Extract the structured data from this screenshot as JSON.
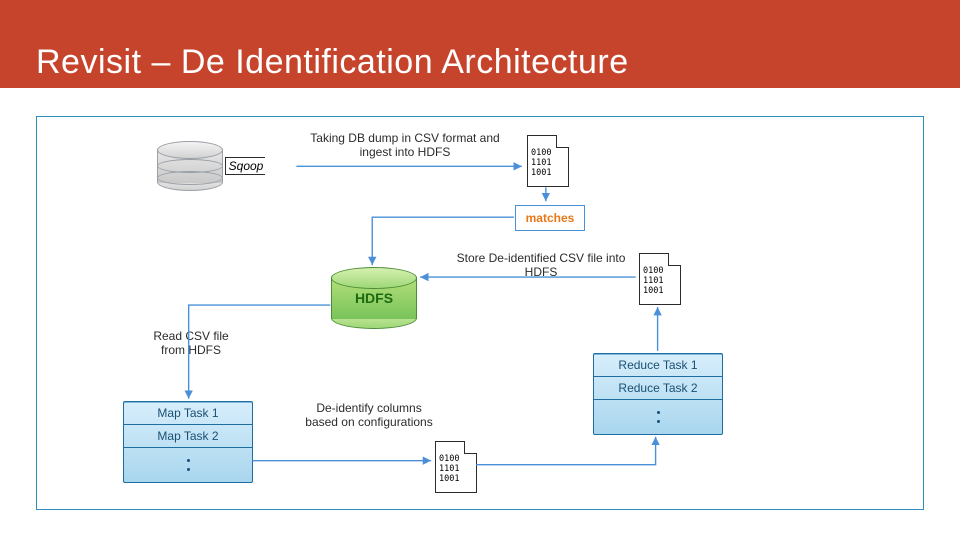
{
  "header": {
    "title": "Revisit – De Identification Architecture"
  },
  "sqoop_label": "Sqoop",
  "binary_text": "0100\n1101\n1001",
  "matches_label": "matches",
  "hdfs_label": "HDFS",
  "labels": {
    "ingest": "Taking DB dump in CSV format and ingest into HDFS",
    "store": "Store De-identified CSV file into HDFS",
    "read": "Read CSV file from HDFS",
    "deid": "De-identify columns based on configurations"
  },
  "map_tasks": [
    "Map Task 1",
    "Map Task 2"
  ],
  "reduce_tasks": [
    "Reduce Task 1",
    "Reduce Task 2"
  ],
  "nodes": {
    "database": {
      "desc": "Source database cylinder"
    },
    "sqoop": {
      "desc": "Sqoop export arrow"
    },
    "csv_in": {
      "desc": "CSV binary file (ingested)"
    },
    "matches": {
      "desc": "matches box"
    },
    "hdfs": {
      "desc": "HDFS store"
    },
    "map_stack": {
      "desc": "Map task stack"
    },
    "csv_mid": {
      "desc": "CSV binary file (intermediate)"
    },
    "reduce_stack": {
      "desc": "Reduce task stack"
    },
    "csv_out": {
      "desc": "CSV binary file (de-identified)"
    }
  },
  "edges": [
    {
      "from": "database",
      "to": "sqoop"
    },
    {
      "from": "sqoop",
      "to": "csv_in"
    },
    {
      "from": "csv_in",
      "to": "matches"
    },
    {
      "from": "matches",
      "to": "hdfs"
    },
    {
      "from": "hdfs",
      "to": "map_stack",
      "label": "read"
    },
    {
      "from": "map_stack",
      "to": "csv_mid",
      "label": "deid"
    },
    {
      "from": "csv_mid",
      "to": "reduce_stack"
    },
    {
      "from": "reduce_stack",
      "to": "csv_out"
    },
    {
      "from": "csv_out",
      "to": "hdfs",
      "label": "store"
    }
  ]
}
